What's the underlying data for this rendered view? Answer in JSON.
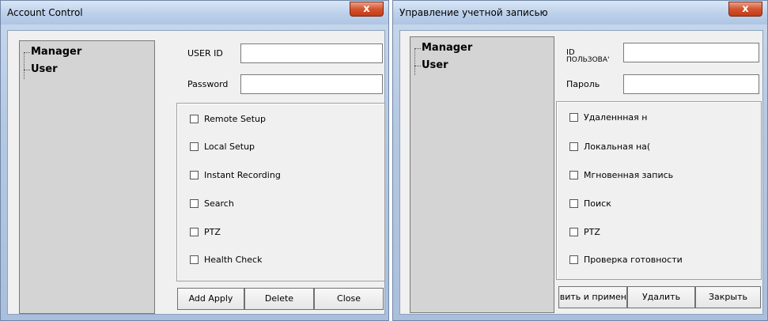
{
  "left": {
    "title": "Account Control",
    "close_glyph": "x",
    "tree": [
      "Manager",
      "User"
    ],
    "userid_label": "USER ID",
    "password_label": "Password",
    "userid_value": "",
    "password_value": "",
    "permissions": [
      "Remote Setup",
      "Local Setup",
      "Instant Recording",
      "Search",
      "PTZ",
      "Health Check"
    ],
    "buttons": [
      "Add Apply",
      "Delete",
      "Close"
    ]
  },
  "right": {
    "title": "Управление учетной записью",
    "close_glyph": "x",
    "tree": [
      "Manager",
      "User"
    ],
    "userid_label_line1": "ID",
    "userid_label_line2": "ПОЛЬЗОВА'",
    "password_label": "Пароль",
    "userid_value": "",
    "password_value": "",
    "permissions": [
      "Удаленнная н",
      "Локальная на(",
      "Мгновенная запись",
      "Поиск",
      "PTZ",
      "Проверка готовности"
    ],
    "buttons": [
      "авить и примен",
      "Удалить",
      "Закрыть"
    ]
  },
  "icons": {
    "close": "close-icon",
    "checkbox": "checkbox-icon"
  }
}
